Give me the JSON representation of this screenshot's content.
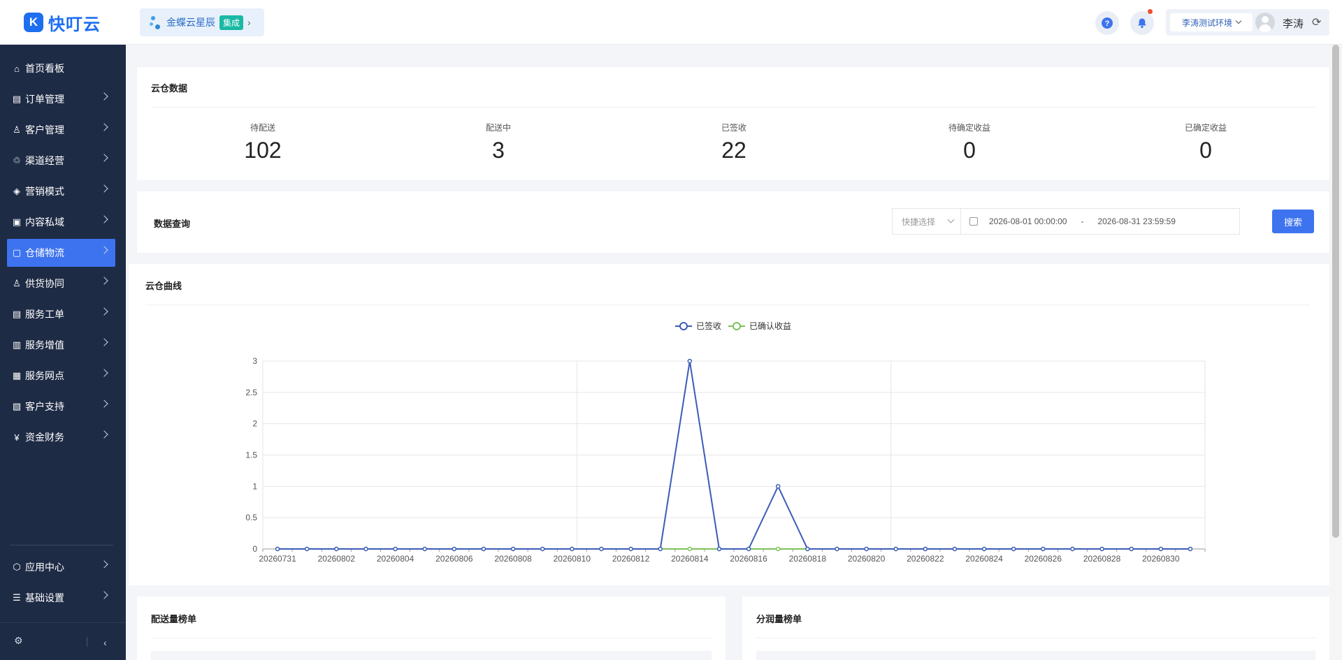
{
  "header": {
    "logo_text": "快叮云",
    "logo_mark": "K",
    "kd_name": "金蝶云星辰",
    "kd_tag": "集成",
    "env_name": "李涛测试环境",
    "user_name": "李涛",
    "icons": [
      "help-icon",
      "bell-icon",
      "refresh-icon"
    ]
  },
  "sidebar": {
    "items": [
      {
        "label": "首页看板",
        "icon": "⌂",
        "arrow": false
      },
      {
        "label": "订单管理",
        "icon": "▤",
        "arrow": true
      },
      {
        "label": "客户管理",
        "icon": "♙",
        "arrow": true
      },
      {
        "label": "渠道经营",
        "icon": "♲",
        "arrow": true
      },
      {
        "label": "营销模式",
        "icon": "◈",
        "arrow": true
      },
      {
        "label": "内容私域",
        "icon": "▣",
        "arrow": true
      },
      {
        "label": "仓储物流",
        "icon": "▢",
        "arrow": true,
        "active": true
      },
      {
        "label": "供货协同",
        "icon": "♙",
        "arrow": true
      },
      {
        "label": "服务工单",
        "icon": "▤",
        "arrow": true
      },
      {
        "label": "服务增值",
        "icon": "▥",
        "arrow": true
      },
      {
        "label": "服务网点",
        "icon": "▦",
        "arrow": true
      },
      {
        "label": "客户支持",
        "icon": "▧",
        "arrow": true
      },
      {
        "label": "资金财务",
        "icon": "¥",
        "arrow": true
      }
    ],
    "bottom_items": [
      {
        "label": "应用中心",
        "icon": "⬡"
      },
      {
        "label": "基础设置",
        "icon": "☰"
      }
    ],
    "collapse_glyph": "‹",
    "settings_glyph": "⚙"
  },
  "cloud_data": {
    "title": "云仓数据",
    "stats": [
      {
        "label": "待配送",
        "value": "102"
      },
      {
        "label": "配送中",
        "value": "3"
      },
      {
        "label": "已签收",
        "value": "22"
      },
      {
        "label": "待确定收益",
        "value": "0"
      },
      {
        "label": "已确定收益",
        "value": "0"
      }
    ]
  },
  "query": {
    "title": "数据查询",
    "quick_select_placeholder": "快捷选择",
    "start": "2026-08-01 00:00:00",
    "separator": "-",
    "end": "2026-08-31 23:59:59",
    "search_label": "搜索"
  },
  "curve": {
    "title": "云仓曲线"
  },
  "rank_delivery": {
    "title": "配送量榜单"
  },
  "rank_profit": {
    "title": "分润量榜单"
  },
  "chart_data": {
    "type": "line",
    "x": [
      "20260731",
      "20260801",
      "20260802",
      "20260803",
      "20260804",
      "20260805",
      "20260806",
      "20260807",
      "20260808",
      "20260809",
      "20260810",
      "20260811",
      "20260812",
      "20260813",
      "20260814",
      "20260815",
      "20260816",
      "20260817",
      "20260818",
      "20260819",
      "20260820",
      "20260821",
      "20260822",
      "20260823",
      "20260824",
      "20260825",
      "20260826",
      "20260827",
      "20260828",
      "20260829",
      "20260830",
      "20260831"
    ],
    "x_tick_labels": [
      "20260731",
      "20260802",
      "20260804",
      "20260806",
      "20260808",
      "20260810",
      "20260812",
      "20260814",
      "20260816",
      "20260818",
      "20260820",
      "20260822",
      "20260824",
      "20260826",
      "20260828",
      "20260830"
    ],
    "series": [
      {
        "name": "已签收",
        "color": "#3b5cb8",
        "values": [
          0,
          0,
          0,
          0,
          0,
          0,
          0,
          0,
          0,
          0,
          0,
          0,
          0,
          0,
          3,
          0,
          0,
          1,
          0,
          0,
          0,
          0,
          0,
          0,
          0,
          0,
          0,
          0,
          0,
          0,
          0,
          0
        ]
      },
      {
        "name": "已确认收益",
        "color": "#7cc25a",
        "values": [
          0,
          0,
          0,
          0,
          0,
          0,
          0,
          0,
          0,
          0,
          0,
          0,
          0,
          0,
          0,
          0,
          0,
          0,
          0,
          0,
          0,
          0,
          0,
          0,
          0,
          0,
          0,
          0,
          0,
          0,
          0,
          0
        ]
      }
    ],
    "y_ticks": [
      "0",
      "0.5",
      "1",
      "1.5",
      "2",
      "2.5",
      "3"
    ],
    "ylim": [
      0,
      3
    ],
    "legend": "top-center",
    "grid": true
  }
}
